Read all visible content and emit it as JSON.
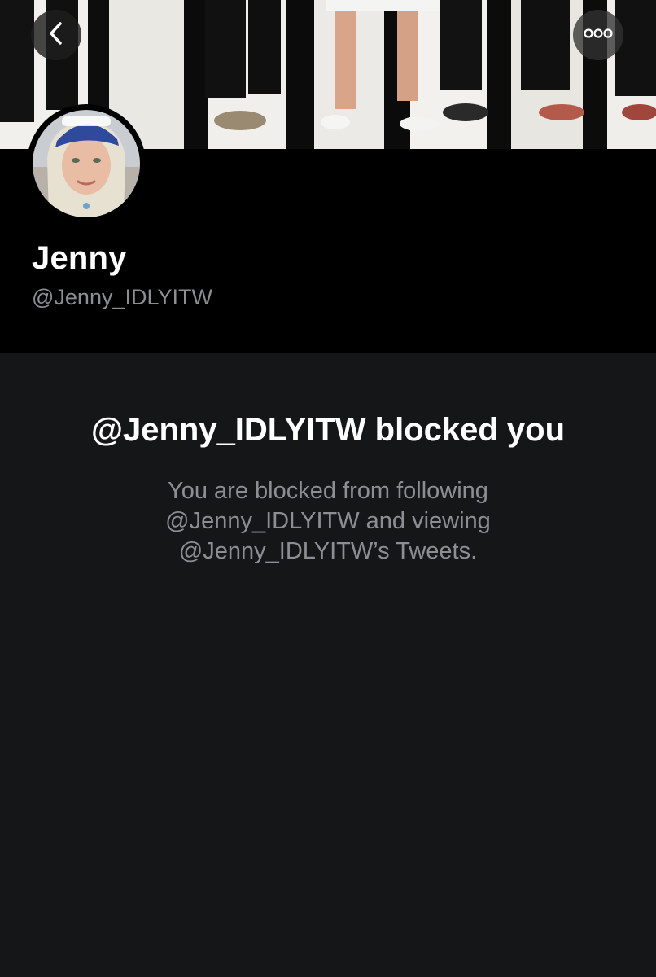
{
  "profile": {
    "display_name": "Jenny",
    "handle": "@Jenny_IDLYITW"
  },
  "blocked_notice": {
    "title": "@Jenny_IDLYITW blocked you",
    "description": "You are blocked from following @Jenny_IDLYITW and viewing @Jenny_IDLYITW’s Tweets."
  },
  "icons": {
    "back": "chevron-left-icon",
    "more": "more-horizontal-icon"
  },
  "colors": {
    "background": "#151618",
    "header_background": "#000000",
    "primary_text": "#ffffff",
    "secondary_text": "#8b8f94"
  }
}
